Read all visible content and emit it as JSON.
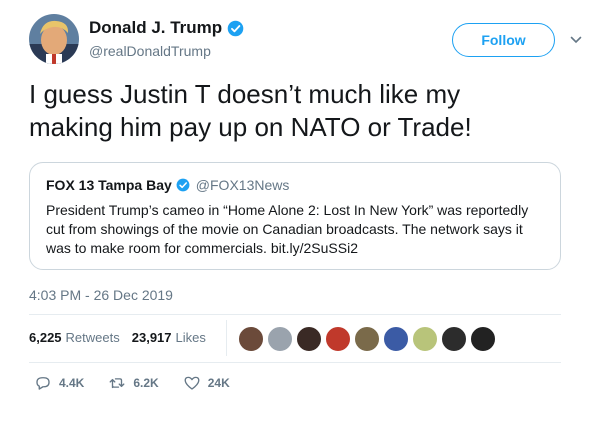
{
  "author": {
    "name": "Donald J. Trump",
    "handle": "@realDonaldTrump",
    "avatar_icon": "profile-photo",
    "verified_color": "#1da1f2"
  },
  "follow_button": {
    "label": "Follow"
  },
  "menu_icon": "chevron-down-icon",
  "tweet": {
    "text": "I guess Justin T doesn’t much like my\nmaking him pay up on NATO or Trade!"
  },
  "quote": {
    "name": "FOX 13 Tampa Bay",
    "handle": "@FOX13News",
    "text": "President Trump’s cameo in “Home Alone 2: Lost In New York” was reportedly cut from showings of the movie on Canadian broadcasts. The network says it was to make room for commercials. bit.ly/2SuSSi2"
  },
  "timestamp": "4:03 PM - 26 Dec 2019",
  "stats": {
    "retweets_count": "6,225",
    "retweets_label": "Retweets",
    "likes_count": "23,917",
    "likes_label": "Likes"
  },
  "likers": [
    {
      "color": "#6b4a3a"
    },
    {
      "color": "#9aa3ad"
    },
    {
      "color": "#3a2a25"
    },
    {
      "color": "#c0392b"
    },
    {
      "color": "#7a6a4a"
    },
    {
      "color": "#3b5ba5"
    },
    {
      "color": "#b8c47a"
    },
    {
      "color": "#2c2c2c"
    },
    {
      "color": "#222222"
    }
  ],
  "actions": {
    "reply_count": "4.4K",
    "retweet_count": "6.2K",
    "like_count": "24K"
  },
  "colors": {
    "accent": "#1da1f2",
    "secondary_text": "#657786",
    "border": "#ccd6dd"
  }
}
